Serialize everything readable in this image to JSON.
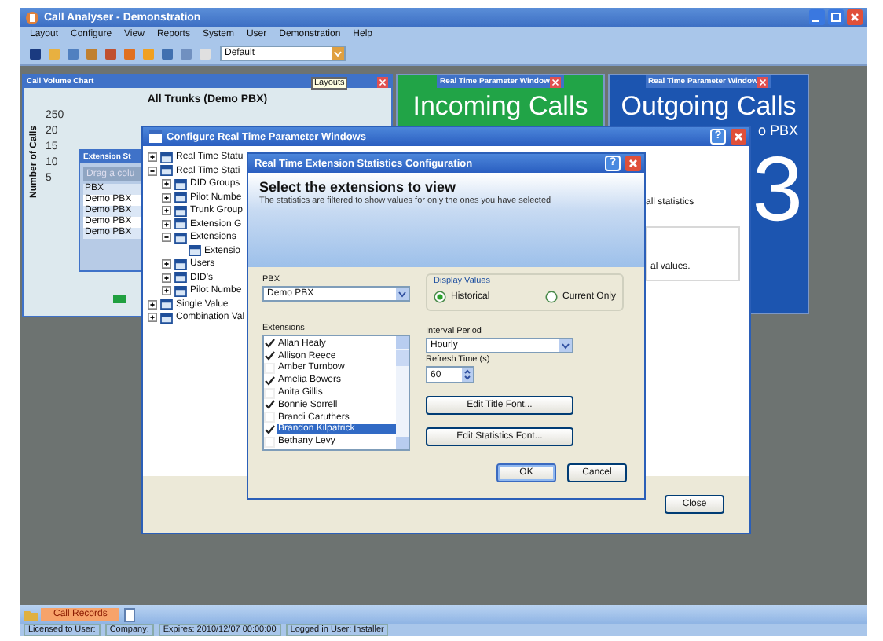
{
  "window": {
    "title": "Call Analyser - Demonstration"
  },
  "menu": [
    "Layout",
    "Configure",
    "View",
    "Reports",
    "System",
    "User",
    "Demonstration",
    "Help"
  ],
  "toolbar": {
    "layout_select": "Default",
    "tooltip": "Layouts"
  },
  "chart_window": {
    "title": "Call Volume Chart",
    "chart_title": "All Trunks (Demo PBX)",
    "ylabel": "Number of Calls",
    "yticks": [
      "250",
      "20",
      "15",
      "10",
      "5"
    ]
  },
  "extension_window": {
    "title": "Extension St",
    "group_hint": "Drag a colu",
    "column": "PBX",
    "rows": [
      "Demo PBX",
      "Demo PBX",
      "Demo PBX",
      "Demo PBX"
    ]
  },
  "parameter_windows": [
    {
      "title": "Real Time Parameter Window",
      "headline": "Incoming Calls",
      "color": "#21a447"
    },
    {
      "title": "Real Time Parameter Window",
      "headline": "Outgoing Calls",
      "subtitle": "o PBX",
      "value": "3",
      "color": "#1c55b0"
    }
  ],
  "configure_dialog": {
    "title": "Configure Real Time Parameter Windows",
    "help": "?",
    "tree": [
      {
        "label": "Real Time Statu",
        "expanded": false
      },
      {
        "label": "Real Time Stati",
        "expanded": true,
        "children": [
          {
            "label": "DID Groups",
            "expanded": false
          },
          {
            "label": "Pilot Numbe",
            "expanded": false
          },
          {
            "label": "Trunk Group",
            "expanded": false
          },
          {
            "label": "Extension G",
            "expanded": false
          },
          {
            "label": "Extensions",
            "expanded": true,
            "children": [
              {
                "label": "Extensio"
              }
            ]
          },
          {
            "label": "Users",
            "expanded": false
          },
          {
            "label": "DID's",
            "expanded": false
          },
          {
            "label": "Pilot Numbe",
            "expanded": false
          }
        ]
      },
      {
        "label": "Single Value",
        "expanded": false
      },
      {
        "label": "Combination Val",
        "expanded": false
      }
    ],
    "description": "all statistics",
    "note": "al values.",
    "close": "Close"
  },
  "extension_dialog": {
    "title": "Real Time Extension Statistics Configuration",
    "help": "?",
    "heading": "Select the extensions to view",
    "subheading": "The statistics are filtered to show values for only the ones you have selected",
    "pbx_label": "PBX",
    "pbx": "Demo PBX",
    "display_label": "Display Values",
    "display_options": [
      {
        "label": "Historical",
        "selected": true
      },
      {
        "label": "Current Only",
        "selected": false
      }
    ],
    "extensions_label": "Extensions",
    "extensions": [
      {
        "name": "Allan Healy",
        "checked": true,
        "selected": false
      },
      {
        "name": "Allison Reece",
        "checked": true,
        "selected": false
      },
      {
        "name": "Amber Turnbow",
        "checked": false,
        "selected": false
      },
      {
        "name": "Amelia Bowers",
        "checked": true,
        "selected": false
      },
      {
        "name": "Anita Gillis",
        "checked": false,
        "selected": false
      },
      {
        "name": "Bonnie Sorrell",
        "checked": true,
        "selected": false
      },
      {
        "name": "Brandi Caruthers",
        "checked": false,
        "selected": false
      },
      {
        "name": "Brandon Kilpatrick",
        "checked": true,
        "selected": true
      },
      {
        "name": "Bethany Levy",
        "checked": false,
        "selected": false
      }
    ],
    "interval_label": "Interval Period",
    "interval": "Hourly",
    "refresh_label": "Refresh Time (s)",
    "refresh": "60",
    "buttons": [
      "Edit Title Font...",
      "Edit Statistics Font..."
    ],
    "ok": "OK",
    "cancel": "Cancel"
  },
  "tabs": [
    {
      "label": "Call Records",
      "selected": true
    }
  ],
  "status_bar": [
    "Licensed to User:",
    "Company:",
    "Expires: 2010/12/07 00:00:00",
    "Logged in User: Installer"
  ]
}
